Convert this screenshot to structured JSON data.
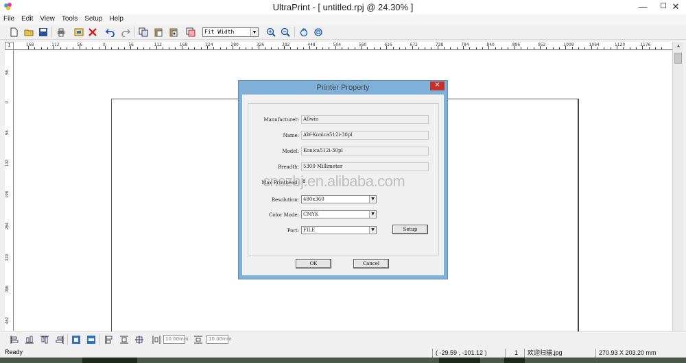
{
  "window": {
    "title": "UltraPrint - [ untitled.rpj @ 24.30% ]",
    "minimize": "—",
    "maximize": "☐",
    "close": "✕"
  },
  "menu": [
    "File",
    "Edit",
    "View",
    "Tools",
    "Setup",
    "Help"
  ],
  "toolbar": {
    "zoom_value": "Fit Width",
    "icons": [
      "new-icon",
      "open-icon",
      "save-icon",
      "print-icon",
      "export-icon",
      "delete-icon",
      "undo-icon",
      "redo-icon",
      "copy-icon",
      "paste-icon",
      "paste-special-icon",
      "layer-icon",
      "zoom-in-icon",
      "zoom-out-icon",
      "fit-icon",
      "actual-size-icon"
    ]
  },
  "ruler": {
    "horizontal": [
      "168",
      "112",
      "56",
      "0",
      "56",
      "112",
      "168",
      "224",
      "280",
      "336",
      "392",
      "448",
      "504",
      "560",
      "616",
      "672",
      "728",
      "784",
      "840",
      "896",
      "952",
      "1008",
      "1064",
      "1120",
      "1176"
    ],
    "vertical": [
      "56",
      "0",
      "56",
      "132",
      "198",
      "264",
      "330",
      "396",
      "462"
    ],
    "corner": "1"
  },
  "bottom_toolbar": {
    "spacing_h": "10.00mm",
    "spacing_v": "10.00mm"
  },
  "status": {
    "ready": "Ready",
    "coords": "( -29.59 , -101.12 )",
    "count": "1",
    "filename": "欢迎扫描.jpg",
    "dims": "270.93 X 203.20 mm"
  },
  "dialog": {
    "title": "Printer Property",
    "close": "✕",
    "fields": {
      "manufacturer": {
        "label": "Manufacturer:",
        "value": "Allwin"
      },
      "name": {
        "label": "Name:",
        "value": "AW-Konica512i-30pl"
      },
      "model": {
        "label": "Model:",
        "value": "Konica512i-30pl"
      },
      "breadth": {
        "label": "Breadth:",
        "value": "5300 Millimeter"
      },
      "printhead": {
        "label": "Max Printhead:",
        "value": "8"
      },
      "resolution": {
        "label": "Resolution:",
        "value": "480x360"
      },
      "color_mode": {
        "label": "Color Mode:",
        "value": "CMYK"
      },
      "port": {
        "label": "Port:",
        "value": "FILE"
      }
    },
    "setup": "Setup",
    "ok": "OK",
    "cancel": "Cancel"
  },
  "watermark": "cnszbj.en.alibaba.com"
}
